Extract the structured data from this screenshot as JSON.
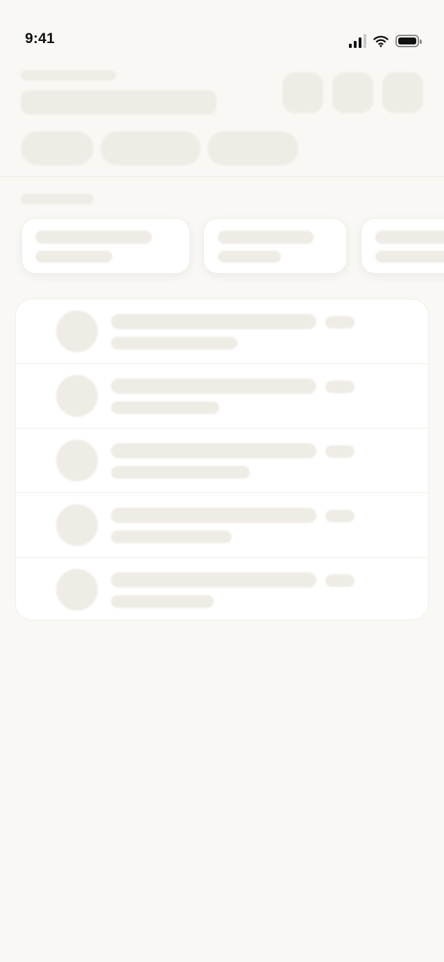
{
  "status_bar": {
    "time": "9:41",
    "signal_icon": "cellular-signal-icon",
    "wifi_icon": "wifi-icon",
    "battery_icon": "battery-icon"
  },
  "screen_state": "loading-skeleton",
  "colors": {
    "background": "#f9f8f5",
    "skeleton": "#efece6",
    "surface": "#ffffff"
  }
}
